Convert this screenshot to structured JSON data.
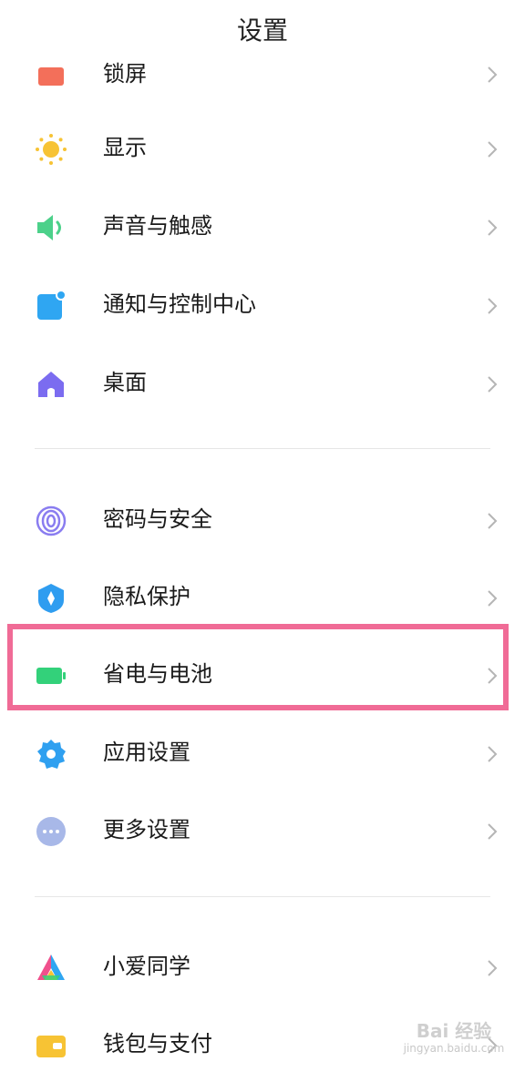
{
  "header": {
    "title": "设置"
  },
  "items": [
    {
      "label": "锁屏",
      "icon": "lock-screen-icon"
    },
    {
      "label": "显示",
      "icon": "sun-icon"
    },
    {
      "label": "声音与触感",
      "icon": "speaker-icon"
    },
    {
      "label": "通知与控制中心",
      "icon": "notification-icon"
    },
    {
      "label": "桌面",
      "icon": "home-icon"
    },
    {
      "label": "密码与安全",
      "icon": "fingerprint-icon"
    },
    {
      "label": "隐私保护",
      "icon": "privacy-shield-icon"
    },
    {
      "label": "省电与电池",
      "icon": "battery-icon"
    },
    {
      "label": "应用设置",
      "icon": "gear-icon"
    },
    {
      "label": "更多设置",
      "icon": "more-dots-icon"
    },
    {
      "label": "小爱同学",
      "icon": "xiaoai-icon"
    },
    {
      "label": "钱包与支付",
      "icon": "wallet-icon"
    }
  ],
  "colors": {
    "highlight": "#f06b96",
    "sun": "#f7c334",
    "speaker": "#4cd18a",
    "notification": "#2fa6f2",
    "home": "#7b6cf0",
    "fingerprint": "#8a7df0",
    "privacy": "#2f9df0",
    "battery": "#33d17a",
    "gear": "#2fa0f0",
    "more": "#a8b8e8",
    "wallet": "#f7c334",
    "lock": "#f36f5a"
  },
  "watermark": {
    "logo": "Bai 经验",
    "sub": "jingyan.baidu.com"
  }
}
